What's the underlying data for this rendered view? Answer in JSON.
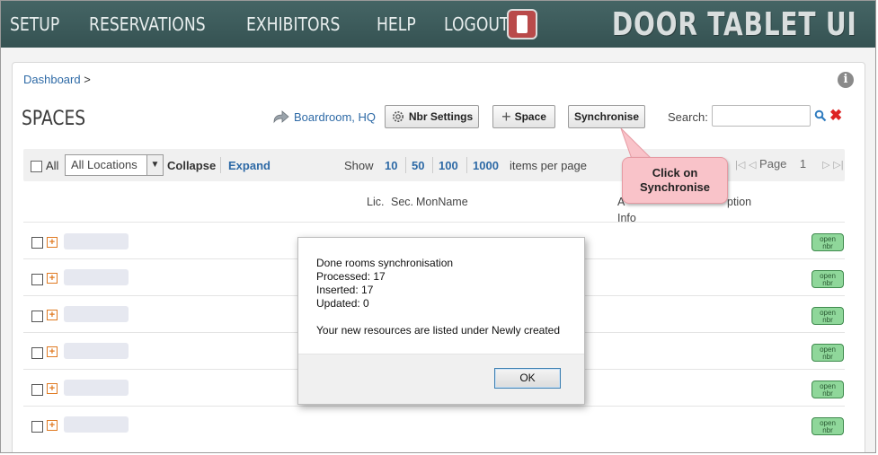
{
  "nav": {
    "items": [
      "SETUP",
      "RESERVATIONS",
      "EXHIBITORS",
      "HELP",
      "LOGOUT"
    ],
    "brand": "DOOR TABLET UI"
  },
  "breadcrumb": {
    "link": "Dashboard",
    "separator": ">"
  },
  "page": {
    "title": "SPACES",
    "location_link": "Boardroom, HQ"
  },
  "buttons": {
    "nbr_settings": "Nbr Settings",
    "space": "Space",
    "synchronise": "Synchronise"
  },
  "search": {
    "label": "Search:",
    "value": ""
  },
  "toolbar": {
    "all_label": "All",
    "location_select": "All Locations",
    "collapse": "Collapse",
    "expand": "Expand",
    "show_label": "Show",
    "per_page_options": [
      "10",
      "50",
      "100",
      "1000"
    ],
    "per_page_suffix": "items per page",
    "page_label": "Page",
    "page_number": "1"
  },
  "table": {
    "headers": {
      "lic": "Lic.",
      "sec": "Sec.",
      "monname": "MonName",
      "info_a": "A",
      "info": "Info",
      "option": "ption"
    },
    "rows": [
      {
        "action": "open\nnbr"
      },
      {
        "action": "open\nnbr"
      },
      {
        "action": "open\nnbr"
      },
      {
        "action": "open\nnbr"
      },
      {
        "action": "open\nnbr"
      },
      {
        "action": "open\nnbr"
      }
    ]
  },
  "callout": {
    "line1": "Click on",
    "line2": "Synchronise"
  },
  "dialog": {
    "line1": "Done rooms synchronisation",
    "line2": "Processed: 17",
    "line3": "Inserted: 17",
    "line4": "Updated: 0",
    "line5": "Your new resources are listed under Newly created",
    "ok": "OK"
  },
  "colors": {
    "topbar": "#3d5b5b",
    "link": "#2e6aa6",
    "callout": "#f9c3c9",
    "open_badge": "#8fd79a"
  }
}
